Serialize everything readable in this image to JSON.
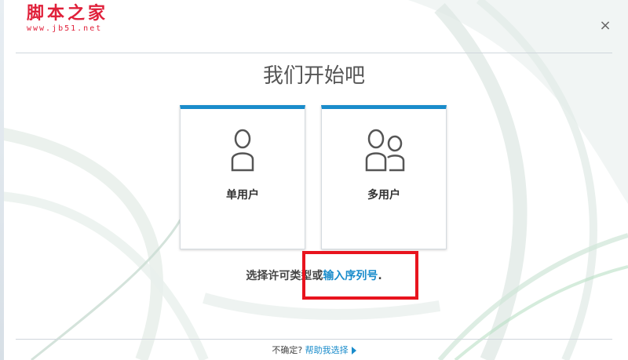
{
  "watermark": {
    "site_name": "脚本之家",
    "url": "www.jb51.net"
  },
  "dialog": {
    "close_symbol": "×",
    "title": "我们开始吧"
  },
  "license_options": [
    {
      "label": "单用户",
      "icon": "single-user-icon"
    },
    {
      "label": "多用户",
      "icon": "multi-user-icon"
    }
  ],
  "prompt": {
    "text": "选择许可类型或",
    "link": "输入序列号",
    "suffix": "."
  },
  "footer": {
    "question": "不确定?",
    "help_link": "帮助我选择"
  },
  "colors": {
    "accent": "#1a8ccb",
    "highlight": "#e8141e",
    "watermark": "#e0203a"
  }
}
